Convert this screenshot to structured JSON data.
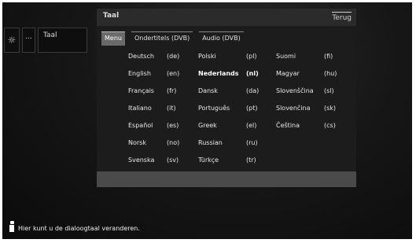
{
  "header": {
    "title": "Taal",
    "back_label": "Terug"
  },
  "left_panel": {
    "gear_glyph": "☼",
    "dots": "...",
    "label": "Taal"
  },
  "tabs": [
    {
      "label": "Menu",
      "active": true
    },
    {
      "label": "Ondertitels (DVB)",
      "active": false
    },
    {
      "label": "Audio (DVB)",
      "active": false
    }
  ],
  "languages": {
    "col1": [
      {
        "name": "Deutsch",
        "code": "(de)"
      },
      {
        "name": "English",
        "code": "(en)"
      },
      {
        "name": "Français",
        "code": "(fr)"
      },
      {
        "name": "Italiano",
        "code": "(it)"
      },
      {
        "name": "Español",
        "code": "(es)"
      },
      {
        "name": "Norsk",
        "code": "(no)"
      },
      {
        "name": "Svenska",
        "code": "(sv)"
      }
    ],
    "col2": [
      {
        "name": "Polski",
        "code": "(pl)"
      },
      {
        "name": "Nederlands",
        "code": "(nl)",
        "selected": true
      },
      {
        "name": "Dansk",
        "code": "(da)"
      },
      {
        "name": "Português",
        "code": "(pt)"
      },
      {
        "name": "Greek",
        "code": "(el)"
      },
      {
        "name": "Russian",
        "code": "(ru)"
      },
      {
        "name": "Türkçe",
        "code": "(tr)"
      }
    ],
    "col3": [
      {
        "name": "Suomi",
        "code": "(fi)"
      },
      {
        "name": "Magyar",
        "code": "(hu)"
      },
      {
        "name": "Slovenščina",
        "code": "(sl)"
      },
      {
        "name": "Slovenčina",
        "code": "(sk)"
      },
      {
        "name": "Čeština",
        "code": "(cs)"
      }
    ]
  },
  "footer": {
    "info_text": "Hier kunt u de dialoogtaal veranderen."
  }
}
